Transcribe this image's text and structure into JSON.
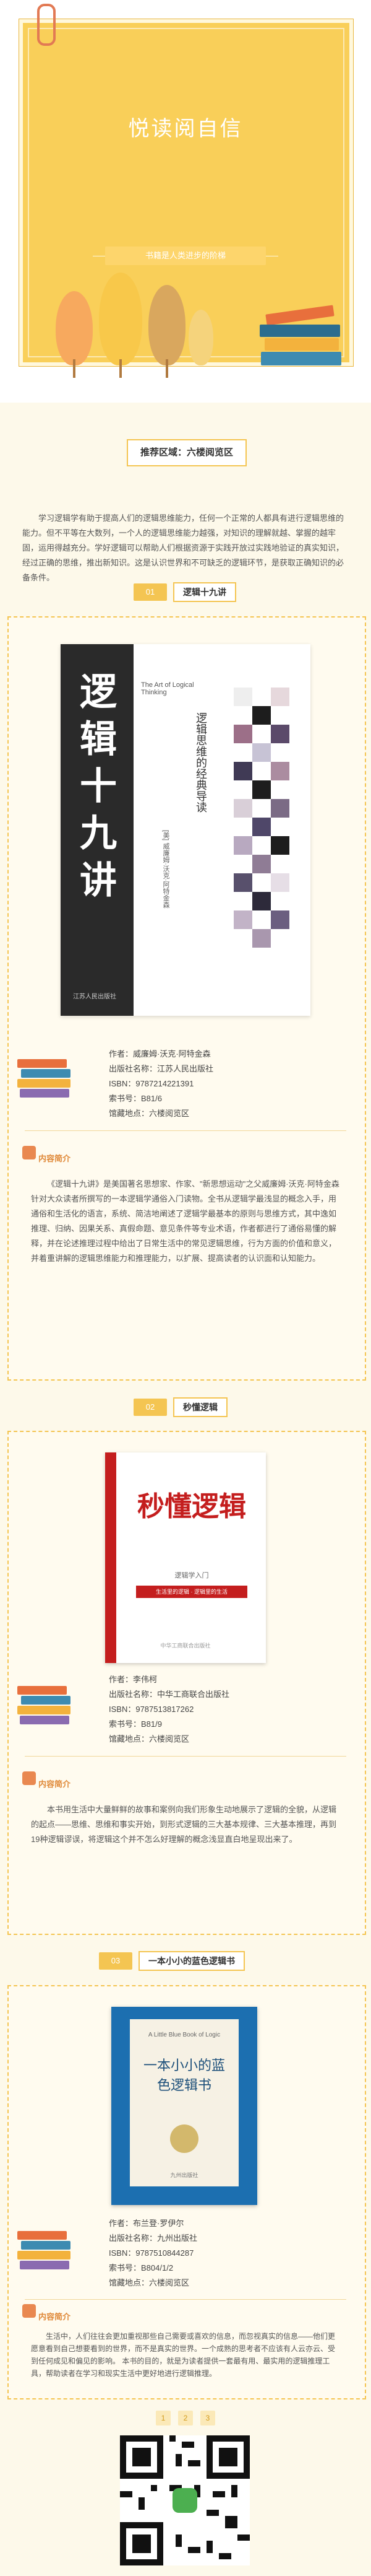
{
  "hero": {
    "title": "悦读阅自信",
    "subtitle": "书籍是人类进步的阶梯"
  },
  "recommend_area": "推荐区域：六楼阅览区",
  "intro": "学习逻辑学有助于提高人们的逻辑思维能力，任何一个正常的人都具有进行逻辑思维的能力。但不平等在大数列，一个人的逻辑思维能力越强，对知识的理解就越、掌握的越牢固，运用得越充分。学好逻辑可以帮助人们根据资源于实践开放过实践地验证的真实知识，经过正确的思维，推出新知识。这是认识世界和不可缺乏的逻辑环节，是获取正确知识的必备条件。",
  "sections": [
    {
      "num": "01",
      "title": "逻辑十九讲",
      "cover": {
        "title": "逻辑十九讲",
        "en": "The Art of Logical Thinking",
        "tag": "逻辑思维的经典导读",
        "author": "[美] 威廉姆·沃克·阿特金森",
        "press": "江苏人民出版社"
      },
      "info": {
        "author": "作者：威廉姆·沃克·阿特金森",
        "press": "出版社名称：江苏人民出版社",
        "isbn": "ISBN：9787214221391",
        "call": "索书号：B81/6",
        "location": "馆藏地点：六楼阅览区"
      },
      "blurb_label": "内容简介",
      "blurb": "《逻辑十九讲》是美国著名思想家、作家、\"新思想运动\"之父威廉姆·沃克·阿特金森针对大众读者所撰写的一本逻辑学通俗入门读物。全书从逻辑学最浅显的概念入手，用通俗和生活化的语言，系统、简洁地阐述了逻辑学最基本的原则与思维方式，其中逸如推理、归纳、因果关系、真假命题、意见条件等专业术语，作者都进行了通俗易懂的解释，并在论述推理过程中给出了日常生活中的常见逻辑思维，行为方面的价值和意义，并着重讲解的逻辑思维能力和推理能力，以扩展、提高读者的认识面和认知能力。"
    },
    {
      "num": "02",
      "title": "秒懂逻辑",
      "cover": {
        "title": "秒懂逻辑",
        "small": "逻辑学入门",
        "band": "生活里的逻辑 · 逻辑里的生活",
        "press": "中华工商联合出版社"
      },
      "info": {
        "author": "作者：李伟柯",
        "press": "出版社名称：中华工商联合出版社",
        "isbn": "ISBN：9787513817262",
        "call": "索书号：B81/9",
        "location": "馆藏地点：六楼阅览区"
      },
      "blurb_label": "内容简介",
      "blurb": "本书用生活中大量鲜鲜的故事和案例向我们形象生动地展示了逻辑的全貌，从逻辑的起点——思维、思维和事实开始，到形式逻辑的三大基本规律、三大基本推理，再到19种逻辑谬误，将逻辑这个并不怎么好理解的概念浅显直白地呈现出来了。"
    },
    {
      "num": "03",
      "title": "一本小小的蓝色逻辑书",
      "cover": {
        "title": "一本小小的蓝色逻辑书",
        "en": "A Little Blue Book of Logic",
        "press": "九州出版社"
      },
      "info": {
        "author": "作者：布兰登·罗伊尔",
        "press": "出版社名称：九州出版社",
        "isbn": "ISBN：9787510844287",
        "call": "索书号：B804/1/2",
        "location": "馆藏地点：六楼阅览区"
      },
      "blurb_label": "内容简介",
      "blurb": "生活中，人们往往会更加重视那些自己需要或喜欢的信息，而忽视真实的信息——他们更愿意看到自己想要看到的世界，而不是真实的世界。一个成熟的思考者不应该有人云亦云、受到任何成见和偏见的影响。 本书的目的，就是为读者提供一套最有用、最实用的逻辑推理工具，帮助读者在学习和现实生活中更好地进行逻辑推理。"
    }
  ],
  "dots": [
    "1",
    "2",
    "3"
  ],
  "colors": {
    "accent": "#f4c552",
    "hero_bg": "#f9cf59",
    "page_bg": "#fdf9ea"
  }
}
